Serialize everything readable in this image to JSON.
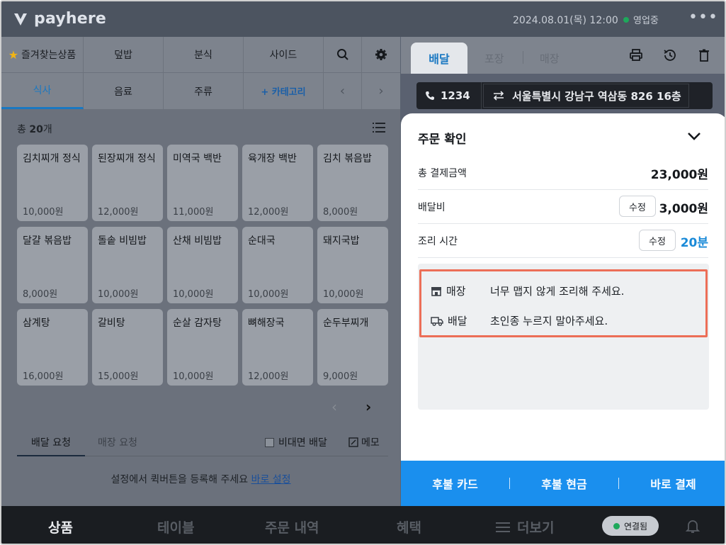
{
  "header": {
    "brand": "payhere",
    "datetime": "2024.08.01(목) 12:00",
    "status": "영업중",
    "status_color": "#1ea85b",
    "more": "•••"
  },
  "categories": {
    "row1": [
      {
        "label": "즐겨찾는상품",
        "icon": "star-icon"
      },
      {
        "label": "덮밥"
      },
      {
        "label": "분식"
      },
      {
        "label": "사이드"
      }
    ],
    "row2": [
      {
        "label": "식사",
        "active": true
      },
      {
        "label": "음료"
      },
      {
        "label": "주류"
      },
      {
        "label": "+ 카테고리"
      }
    ],
    "accent": "#1a78c2"
  },
  "products": {
    "count_prefix": "총",
    "count_value": "20",
    "count_suffix": "개",
    "items": [
      {
        "name": "김치찌개 정식",
        "price": "10,000원"
      },
      {
        "name": "된장찌개 정식",
        "price": "12,000원"
      },
      {
        "name": "미역국 백반",
        "price": "11,000원"
      },
      {
        "name": "육개장 백반",
        "price": "12,000원"
      },
      {
        "name": "김치 볶음밥",
        "price": "8,000원"
      },
      {
        "name": "달걀 볶음밥",
        "price": "8,000원"
      },
      {
        "name": "돌솥 비빔밥",
        "price": "10,000원"
      },
      {
        "name": "산채 비빔밥",
        "price": "10,000원"
      },
      {
        "name": "순대국",
        "price": "10,000원"
      },
      {
        "name": "돼지국밥",
        "price": "10,000원"
      },
      {
        "name": "삼계탕",
        "price": "16,000원"
      },
      {
        "name": "갈비탕",
        "price": "15,000원"
      },
      {
        "name": "순살 감자탕",
        "price": "10,000원"
      },
      {
        "name": "뼈해장국",
        "price": "12,000원"
      },
      {
        "name": "순두부찌개",
        "price": "9,000원"
      }
    ]
  },
  "requests": {
    "tab_delivery": "배달 요청",
    "tab_store": "매장 요청",
    "contactless": "비대면 배달",
    "memo": "메모",
    "note": "설정에서 퀵버튼을 등록해 주세요",
    "note_link": "바로 설정"
  },
  "order": {
    "tabs": {
      "delivery": "배달",
      "takeout": "포장",
      "store": "매장"
    },
    "phone": "1234",
    "address": "서울특별시 강남구 역삼동 826 16층",
    "sheet_title": "주문 확인",
    "total_label": "총 결제금액",
    "total_value": "23,000원",
    "delivery_fee_label": "배달비",
    "delivery_fee_value": "3,000원",
    "cook_time_label": "조리 시간",
    "cook_time_value": "20분",
    "edit_label": "수정",
    "store_request_tag": "매장",
    "store_request_text": "너무 맵지 않게 조리해 주세요.",
    "delivery_request_tag": "배달",
    "delivery_request_text": "초인종 누르지 말아주세요.",
    "highlight_color": "#ec6e57",
    "pay_buttons": [
      "후불 카드",
      "후불 현금",
      "바로 결제"
    ],
    "pay_color": "#1a8fee"
  },
  "bottom_nav": {
    "items": [
      "상품",
      "테이블",
      "주문 내역",
      "혜택",
      "더보기"
    ],
    "active": "상품",
    "connection": "연결됨"
  }
}
